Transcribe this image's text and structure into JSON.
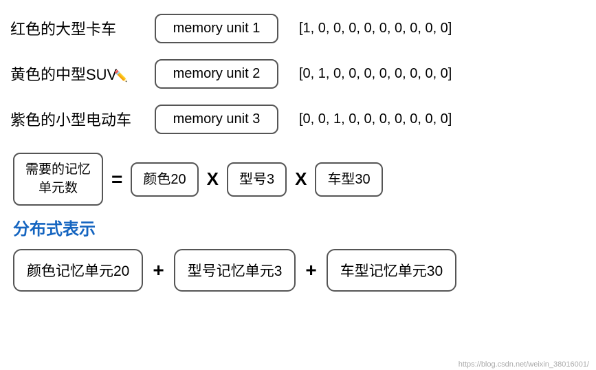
{
  "rows": [
    {
      "label": "红色的大型卡车",
      "memory_unit": "memory unit 1",
      "vector": "[1, 0, 0, 0, 0, 0, 0, 0, 0, 0]",
      "has_pencil": false
    },
    {
      "label": "黄色的中型SUV",
      "memory_unit": "memory unit 2",
      "vector": "[0, 1, 0, 0, 0, 0, 0, 0, 0, 0]",
      "has_pencil": true
    },
    {
      "label": "紫色的小型电动车",
      "memory_unit": "memory unit 3",
      "vector": "[0, 0, 1, 0, 0, 0, 0, 0, 0, 0]",
      "has_pencil": false
    }
  ],
  "formula": {
    "label_line1": "需要的记忆",
    "label_line2": "单元数",
    "equals": "=",
    "parts": [
      {
        "text": "颜色20",
        "x_after": true
      },
      {
        "text": "型号3",
        "x_after": true
      },
      {
        "text": "车型30",
        "x_after": false
      }
    ]
  },
  "distributed_title": "分布式表示",
  "bottom_parts": [
    {
      "text": "颜色记忆单元20",
      "plus_after": true
    },
    {
      "text": "型号记忆单元3",
      "plus_after": true
    },
    {
      "text": "车型记忆单元30",
      "plus_after": false
    }
  ],
  "watermark": "https://blog.csdn.net/weixin_38016001/"
}
